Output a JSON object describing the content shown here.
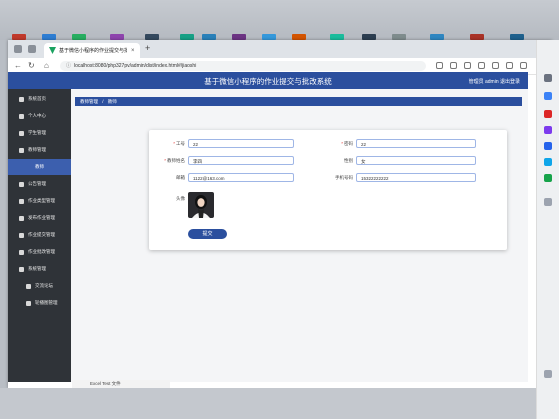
{
  "browser": {
    "tab_title": "基于微信小程序的作业提交与批改",
    "tab_close": "×",
    "new_tab": "+",
    "url": "localhost:8080/php327pv/admin/dist/index.html#/jiaoshi",
    "download_item": "Excel Test 文件"
  },
  "app": {
    "title": "基于微信小程序的作业提交与批改系统",
    "user_info": "管理员 admin  退出登录"
  },
  "sidebar": {
    "items": [
      {
        "label": "系统首页",
        "icon": "home-icon"
      },
      {
        "label": "个人中心",
        "icon": "user-icon"
      },
      {
        "label": "学生管理",
        "icon": "users-icon"
      },
      {
        "label": "教师管理",
        "icon": "teacher-icon"
      },
      {
        "label": "教师",
        "icon": "list-icon"
      },
      {
        "label": "公告管理",
        "icon": "notice-icon"
      },
      {
        "label": "作业类型管理",
        "icon": "folder-icon"
      },
      {
        "label": "发布作业管理",
        "icon": "publish-icon"
      },
      {
        "label": "作业提交管理",
        "icon": "upload-icon"
      },
      {
        "label": "作业批改管理",
        "icon": "check-icon"
      },
      {
        "label": "系统管理",
        "icon": "gear-icon"
      },
      {
        "label": "交流论坛",
        "icon": "forum-icon"
      },
      {
        "label": "轮播图管理",
        "icon": "image-icon"
      }
    ]
  },
  "breadcrumb": {
    "root": "教师管理",
    "separator": "/",
    "current": "教师"
  },
  "form": {
    "fields": [
      {
        "label": "工号",
        "required": true,
        "value": "22"
      },
      {
        "label": "密码",
        "required": true,
        "value": "22"
      },
      {
        "label": "教师姓名",
        "required": true,
        "value": "李四"
      },
      {
        "label": "性别",
        "required": false,
        "value": "女"
      },
      {
        "label": "邮箱",
        "required": false,
        "value": "1122@163.com"
      },
      {
        "label": "手机号码",
        "required": false,
        "value": "15322222222"
      }
    ],
    "avatar_label": "头像",
    "submit_label": "提交"
  },
  "colors": {
    "primary": "#2b4f9e",
    "sidebar": "#2f3338",
    "active_item": "#3c5fae"
  }
}
